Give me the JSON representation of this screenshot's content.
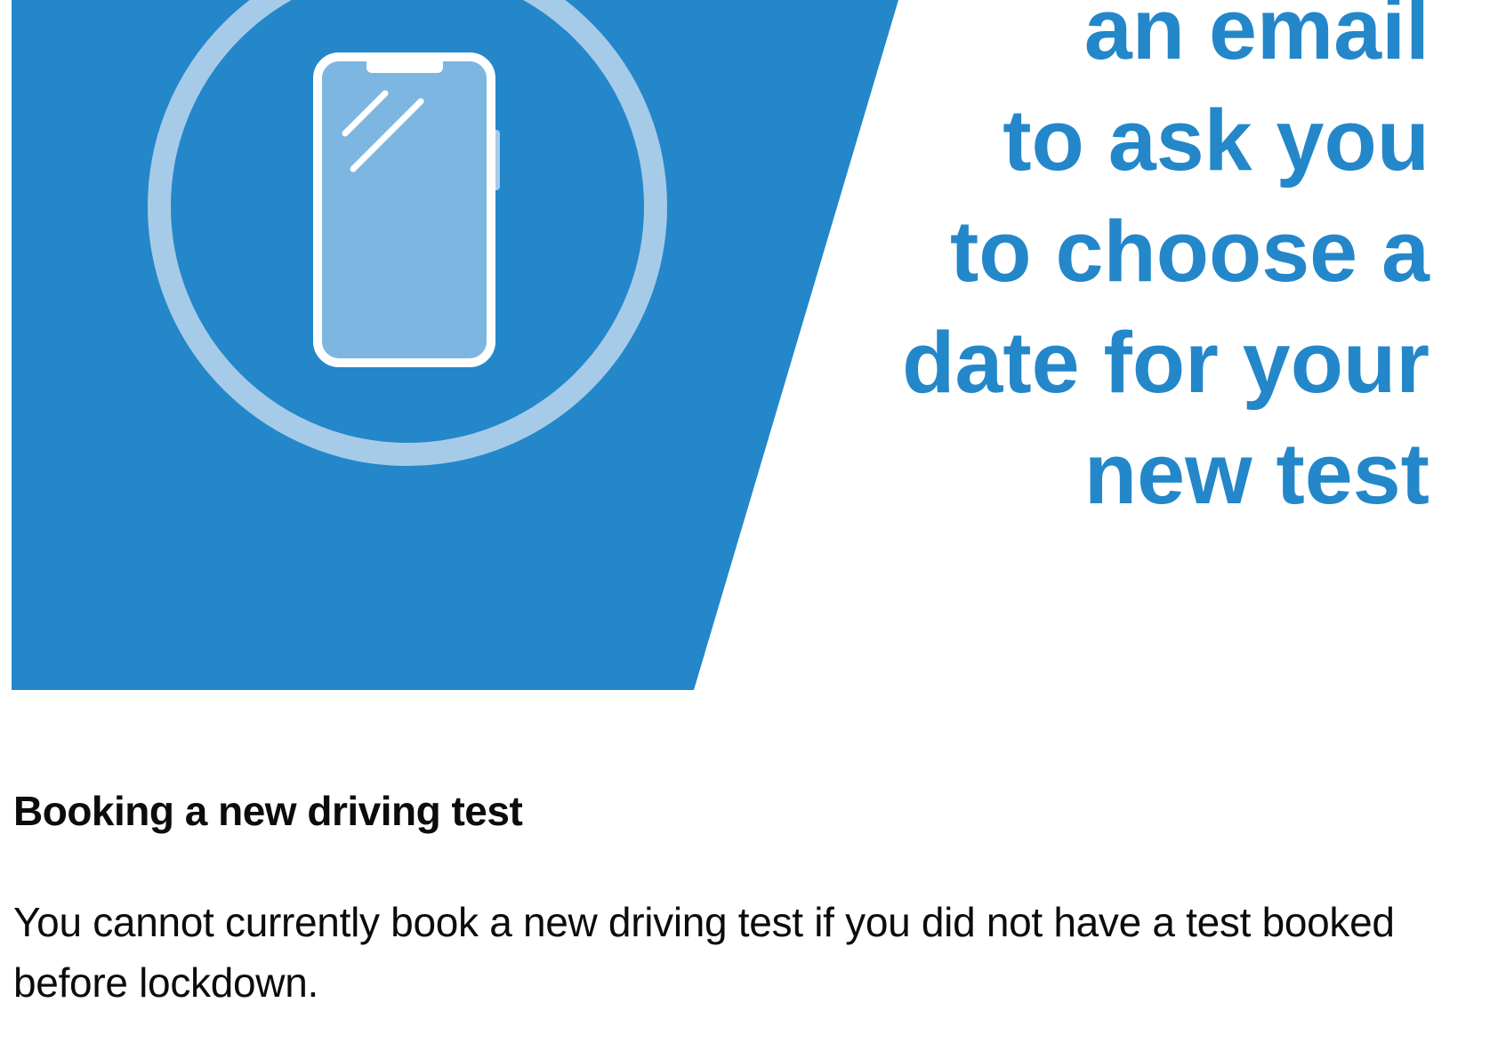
{
  "banner": {
    "headline_lines": [
      "an email",
      "to ask you",
      "to choose a",
      "date for your",
      "new test"
    ],
    "icon": "smartphone-icon",
    "colors": {
      "panel_blue": "#2387ca",
      "ring_light_blue": "#a6cbe8",
      "phone_screen": "#7db6e0",
      "headline_text": "#2387ca"
    }
  },
  "content": {
    "heading": "Booking a new driving test",
    "paragraph": "You cannot currently book a new driving test if you did not have a test booked before lockdown."
  }
}
